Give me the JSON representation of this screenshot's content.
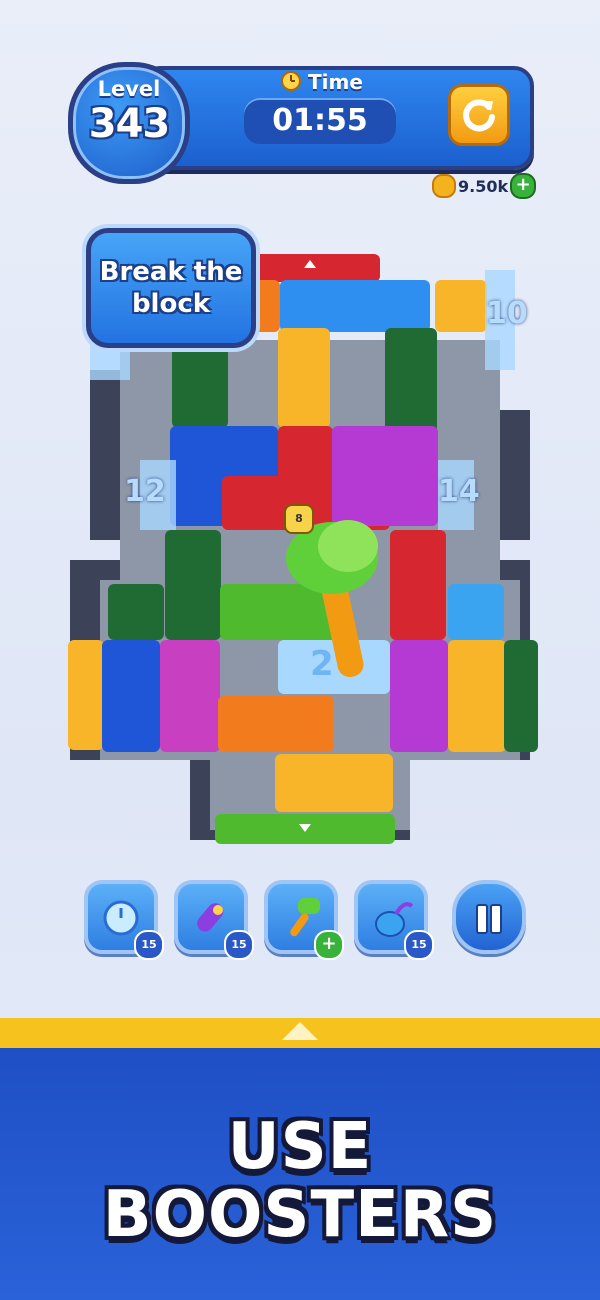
{
  "hud": {
    "level_label": "Level",
    "level_number": "343",
    "time_label": "Time",
    "time_value": "01:55",
    "restart_icon": "restart-icon",
    "coins": "9.50k",
    "coin_add_icon": "plus-icon"
  },
  "board": {
    "tooltip_line1": "Break the",
    "tooltip_line2": "block",
    "numbers": {
      "right_top": "10",
      "left_mid": "12",
      "right_mid": "14",
      "frozen": "2",
      "lock": "8"
    },
    "colors": {
      "red": "#d6262f",
      "blue": "#1f56d8",
      "orange": "#f27b1e",
      "yellow": "#f8b52a",
      "green": "#1f6b33",
      "lime": "#4fba2e",
      "purple": "#b53ad4",
      "magenta": "#c93fc2",
      "sky": "#3aa4f0",
      "frame": "#3c4258"
    }
  },
  "boosters": [
    {
      "icon": "frozen-clock-icon",
      "count": "15"
    },
    {
      "icon": "rocket-icon",
      "count": "15"
    },
    {
      "icon": "hammer-icon",
      "badge": "+"
    },
    {
      "icon": "vacuum-icon",
      "count": "15"
    }
  ],
  "pause_icon": "pause-icon",
  "banner": {
    "line1": "USE",
    "line2": "BOOSTERS"
  }
}
